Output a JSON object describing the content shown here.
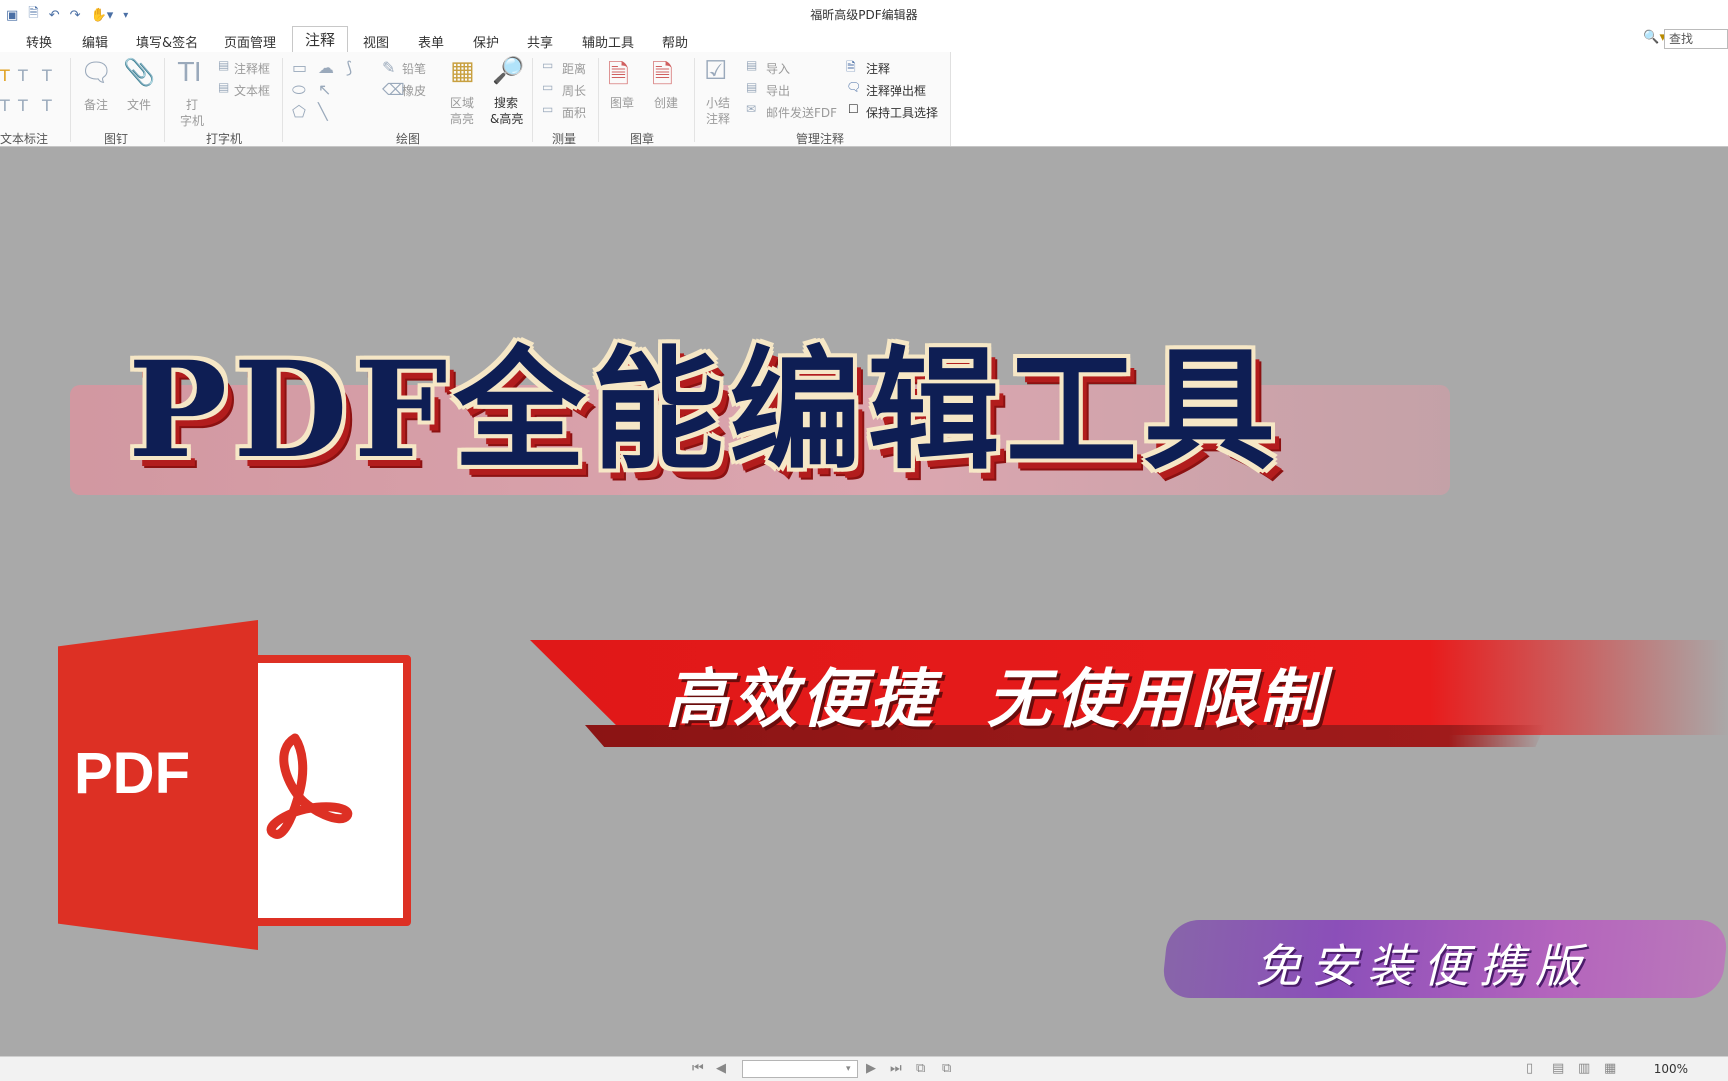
{
  "window": {
    "title": "福昕高级PDF编辑器"
  },
  "qat_icons": [
    "app-icon",
    "new-icon",
    "undo-icon",
    "redo-icon",
    "hand-tool-icon"
  ],
  "tabs": [
    {
      "label": "转换"
    },
    {
      "label": "编辑"
    },
    {
      "label": "填写&签名"
    },
    {
      "label": "页面管理"
    },
    {
      "label": "注释",
      "active": true
    },
    {
      "label": "视图"
    },
    {
      "label": "表单"
    },
    {
      "label": "保护"
    },
    {
      "label": "共享"
    },
    {
      "label": "辅助工具"
    },
    {
      "label": "帮助"
    }
  ],
  "search": {
    "placeholder": "查找"
  },
  "ribbon": {
    "groups": {
      "text_markup": "文本标注",
      "pin": "图钉",
      "typewriter": "打字机",
      "drawing": "绘图",
      "measure": "测量",
      "stamp": "图章",
      "manage": "管理注释"
    },
    "items": {
      "note": "备注",
      "file": "文件",
      "type_1": "打",
      "type_2": "字机",
      "callout": "注释框",
      "textbox": "文本框",
      "pencil": "铅笔",
      "eraser": "橡皮",
      "area_hl_1": "区域",
      "area_hl_2": "高亮",
      "search_hl_1": "搜索",
      "search_hl_2": "&高亮",
      "distance": "距离",
      "perimeter": "周长",
      "area": "面积",
      "stamp": "图章",
      "create": "创建",
      "summary_1": "小结",
      "summary_2": "注释",
      "import": "导入",
      "export": "导出",
      "email_fdf": "邮件发送FDF",
      "comment": "注释",
      "comment_popup": "注释弹出框",
      "keep_tool": "保持工具选择"
    }
  },
  "banner": {
    "headline": "PDF全能编辑工具",
    "sub_1": "高效便捷",
    "sub_2": "无使用限制",
    "tag": "免安装便携版",
    "logo_text": "PDF"
  },
  "status": {
    "zoom": "100%"
  },
  "colors": {
    "stage_bg": "#a9a9a9",
    "headline": "#0e1e54",
    "band_red": "#e01818",
    "pdf_red": "#dd3024",
    "purple": "#8b4fb9"
  }
}
